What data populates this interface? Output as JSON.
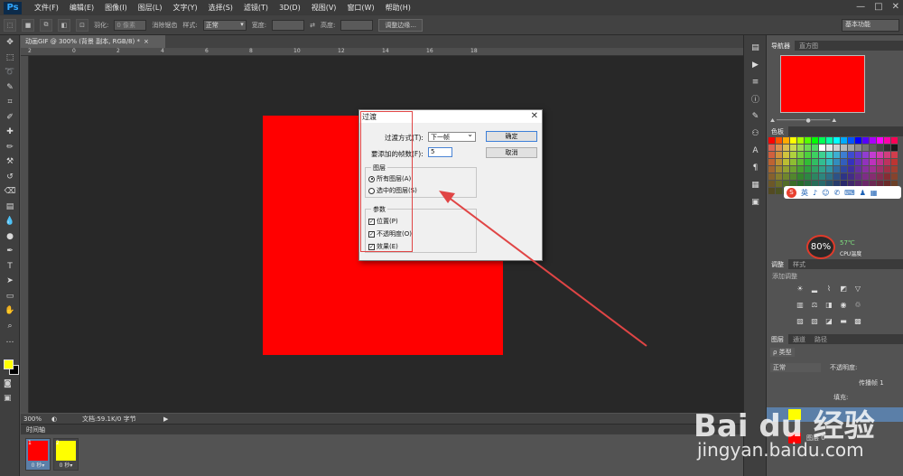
{
  "app": {
    "logo": "Ps",
    "menu": [
      "文件(F)",
      "编辑(E)",
      "图像(I)",
      "图层(L)",
      "文字(Y)",
      "选择(S)",
      "滤镜(T)",
      "3D(D)",
      "视图(V)",
      "窗口(W)",
      "帮助(H)"
    ],
    "window_controls": [
      "—",
      "□",
      "✕"
    ]
  },
  "options_bar": {
    "feather_label": "羽化:",
    "feather_value": "0 像素",
    "antialias_label": "消除锯齿",
    "style_label": "样式:",
    "style_value": "正常",
    "width_label": "宽度:",
    "height_label": "高度:",
    "refine_edge": "调整边缘...",
    "workspace": "基本功能"
  },
  "document": {
    "tab_title": "动画GIF @ 300% (背景 副本, RGB/8) *",
    "tab_close": "×",
    "ruler_marks": [
      "2",
      "0",
      "2",
      "4",
      "6",
      "8",
      "10",
      "12",
      "14",
      "16",
      "18"
    ],
    "zoom": "300%",
    "doc_info": "文档:59.1K/0 字节",
    "canvas_color": "#ff0000"
  },
  "timeline": {
    "title": "时间轴",
    "frames": [
      {
        "num": "1",
        "color": "#ff0000",
        "delay": "0 秒▾"
      },
      {
        "num": "2",
        "color": "#ffff00",
        "delay": "0 秒▾"
      }
    ]
  },
  "right_panels": {
    "navigator_tabs": [
      "导航器",
      "直方图"
    ],
    "color_tabs": [
      "色板"
    ],
    "adjust_tabs": [
      "调整",
      "样式"
    ],
    "adjust_subtitle": "添加调整",
    "layer_tabs": [
      "图层",
      "通道",
      "路径"
    ],
    "layer_kind": "ρ 类型",
    "blend_mode": "正常",
    "opacity_label": "不透明度:",
    "propagate_label": "传播帧 1",
    "fill_label": "填充:",
    "layer_name": "图层 0"
  },
  "dialog": {
    "title": "过渡",
    "close": "✕",
    "method_label": "过渡方式(T):",
    "method_value": "下一帧",
    "frames_label": "要添加的帧数(F):",
    "frames_value": "5",
    "ok": "确定",
    "cancel": "取消",
    "layers_group": "图层",
    "all_layers": "所有图层(A)",
    "selected_layers": "选中的图层(S)",
    "params_group": "参数",
    "position": "位置(P)",
    "opacity": "不透明度(O)",
    "effects": "效果(E)"
  },
  "cpu_widget": {
    "usage": "80%",
    "temp": "57℃",
    "label": "CPU温度"
  },
  "ime_bar": {
    "logo": "S",
    "mode": "英"
  },
  "watermark": {
    "brand": "Bai du 经验",
    "url": "jingyan.baidu.com"
  },
  "colors": {
    "annotation": "#e04545",
    "primary_fg": "#ffff00",
    "primary_bg": "#000000"
  }
}
